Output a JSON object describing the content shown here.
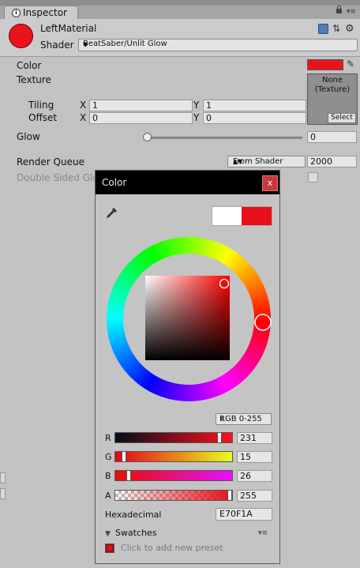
{
  "tab": {
    "label": "Inspector",
    "icon": "info-icon"
  },
  "header": {
    "material_name": "LeftMaterial",
    "shader_label": "Shader",
    "shader_value": "BeatSaber/Unlit Glow",
    "material_color": "#e8141c"
  },
  "properties": {
    "color_label": "Color",
    "texture_label": "Texture",
    "texture_none": "None",
    "texture_type": "(Texture)",
    "texture_select": "Select",
    "tiling_label": "Tiling",
    "offset_label": "Offset",
    "x_label": "X",
    "y_label": "Y",
    "tiling_x": "1",
    "tiling_y": "1",
    "offset_x": "0",
    "offset_y": "0",
    "glow_label": "Glow",
    "glow_value": "0",
    "glow_fraction": 0,
    "render_queue_label": "Render Queue",
    "render_queue_mode": "From Shader",
    "render_queue_value": "2000",
    "double_sided_label": "Double Sided Glo"
  },
  "color_window": {
    "title": "Color",
    "close": "x",
    "mode": "RGB 0-255",
    "channels": [
      {
        "label": "R",
        "value": "231",
        "fraction": 0.906
      },
      {
        "label": "G",
        "value": "15",
        "fraction": 0.059
      },
      {
        "label": "B",
        "value": "26",
        "fraction": 0.102
      },
      {
        "label": "A",
        "value": "255",
        "fraction": 1.0
      }
    ],
    "hex_label": "Hexadecimal",
    "hex_value": "E70F1A",
    "swatches_label": "Swatches",
    "preset_label": "Click to add new preset",
    "new_color": "#ffffff",
    "old_color": "#e70f1a"
  }
}
